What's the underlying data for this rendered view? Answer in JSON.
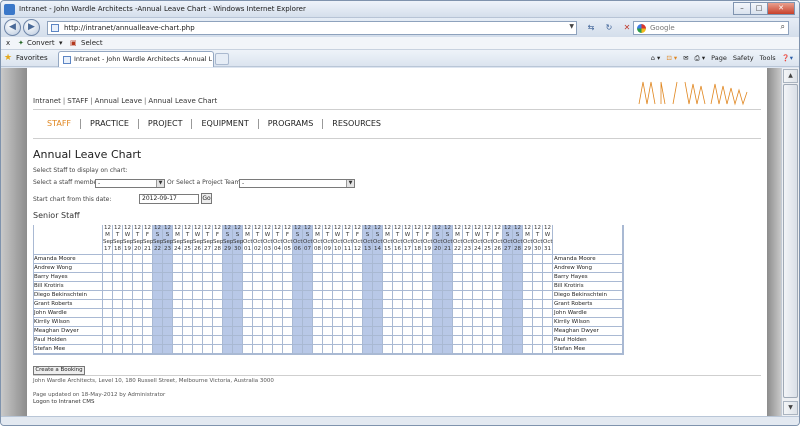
{
  "browser": {
    "window_title": "Intranet - John Wardle Architects -Annual Leave Chart - Windows Internet Explorer",
    "address": "http://intranet/annualleave-chart.php",
    "search_placeholder": "Google",
    "cmd_convert": "Convert",
    "cmd_select": "Select",
    "favorites": "Favorites",
    "tab_title": "Intranet - John Wardle Architects -Annual Leave ...",
    "tools": [
      "Page",
      "Safety",
      "Tools"
    ]
  },
  "page": {
    "breadcrumb": [
      "Intranet",
      "STAFF",
      "Annual Leave",
      "Annual Leave Chart"
    ],
    "logo_text": "JWA",
    "nav": [
      "STAFF",
      "PRACTICE",
      "PROJECT",
      "EQUIPMENT",
      "PROGRAMS",
      "RESOURCES"
    ],
    "title": "Annual Leave Chart",
    "instruction": "Select Staff to display on chart:",
    "staff_label": "Select a staff member",
    "staff_value": "-",
    "or_label": "Or Select a Project Team",
    "team_value": "-",
    "date_label": "Start chart from this date:",
    "date_value": "2012-09-17",
    "go_label": "Go",
    "section": "Senior Staff",
    "booking_button": "Create a Booking",
    "footer_address": "John Wardle Architects, Level 10, 180 Russell Street, Melbourne Victoria, Australia 3000",
    "footer_updated": "Page updated on 18-May-2012 by Administrator",
    "footer_logon": "Logon to Intranet CMS"
  },
  "chart": {
    "year": "12",
    "days": [
      {
        "wd": "M",
        "m": "Sep",
        "d": "17"
      },
      {
        "wd": "T",
        "m": "Sep",
        "d": "18"
      },
      {
        "wd": "W",
        "m": "Sep",
        "d": "19"
      },
      {
        "wd": "T",
        "m": "Sep",
        "d": "20"
      },
      {
        "wd": "F",
        "m": "Sep",
        "d": "21"
      },
      {
        "wd": "S",
        "m": "Sep",
        "d": "22"
      },
      {
        "wd": "S",
        "m": "Sep",
        "d": "23"
      },
      {
        "wd": "M",
        "m": "Sep",
        "d": "24"
      },
      {
        "wd": "T",
        "m": "Sep",
        "d": "25"
      },
      {
        "wd": "W",
        "m": "Sep",
        "d": "26"
      },
      {
        "wd": "T",
        "m": "Sep",
        "d": "27"
      },
      {
        "wd": "F",
        "m": "Sep",
        "d": "28"
      },
      {
        "wd": "S",
        "m": "Sep",
        "d": "29"
      },
      {
        "wd": "S",
        "m": "Sep",
        "d": "30"
      },
      {
        "wd": "M",
        "m": "Oct",
        "d": "01"
      },
      {
        "wd": "T",
        "m": "Oct",
        "d": "02"
      },
      {
        "wd": "W",
        "m": "Oct",
        "d": "03"
      },
      {
        "wd": "T",
        "m": "Oct",
        "d": "04"
      },
      {
        "wd": "F",
        "m": "Oct",
        "d": "05"
      },
      {
        "wd": "S",
        "m": "Oct",
        "d": "06"
      },
      {
        "wd": "S",
        "m": "Oct",
        "d": "07"
      },
      {
        "wd": "M",
        "m": "Oct",
        "d": "08"
      },
      {
        "wd": "T",
        "m": "Oct",
        "d": "09"
      },
      {
        "wd": "W",
        "m": "Oct",
        "d": "10"
      },
      {
        "wd": "T",
        "m": "Oct",
        "d": "11"
      },
      {
        "wd": "F",
        "m": "Oct",
        "d": "12"
      },
      {
        "wd": "S",
        "m": "Oct",
        "d": "13"
      },
      {
        "wd": "S",
        "m": "Oct",
        "d": "14"
      },
      {
        "wd": "M",
        "m": "Oct",
        "d": "15"
      },
      {
        "wd": "T",
        "m": "Oct",
        "d": "16"
      },
      {
        "wd": "W",
        "m": "Oct",
        "d": "17"
      },
      {
        "wd": "T",
        "m": "Oct",
        "d": "18"
      },
      {
        "wd": "F",
        "m": "Oct",
        "d": "19"
      },
      {
        "wd": "S",
        "m": "Oct",
        "d": "20"
      },
      {
        "wd": "S",
        "m": "Oct",
        "d": "21"
      },
      {
        "wd": "M",
        "m": "Oct",
        "d": "22"
      },
      {
        "wd": "T",
        "m": "Oct",
        "d": "23"
      },
      {
        "wd": "W",
        "m": "Oct",
        "d": "24"
      },
      {
        "wd": "T",
        "m": "Oct",
        "d": "25"
      },
      {
        "wd": "F",
        "m": "Oct",
        "d": "26"
      },
      {
        "wd": "S",
        "m": "Oct",
        "d": "27"
      },
      {
        "wd": "S",
        "m": "Oct",
        "d": "28"
      },
      {
        "wd": "M",
        "m": "Oct",
        "d": "29"
      },
      {
        "wd": "T",
        "m": "Oct",
        "d": "30"
      },
      {
        "wd": "W",
        "m": "Oct",
        "d": "31"
      }
    ],
    "staff": [
      "Amanda Moore",
      "Andrew Wong",
      "Barry Hayes",
      "Bill Krotiris",
      "Diego Bekinschtein",
      "Grant Roberts",
      "John Wardle",
      "Kirrily Wilson",
      "Meaghan Dwyer",
      "Paul Holden",
      "Stefan Mee"
    ],
    "weekend_color": "#b8c8e7",
    "accent_color": "#e0861f"
  }
}
